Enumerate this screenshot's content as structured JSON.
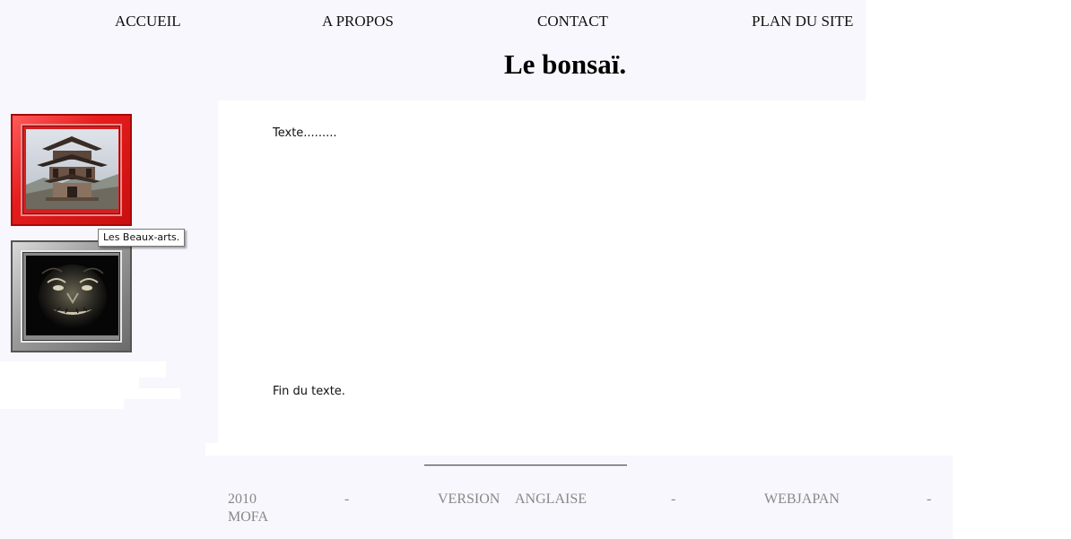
{
  "nav": {
    "items": [
      {
        "label": "ACCUEIL"
      },
      {
        "label": "A PROPOS"
      },
      {
        "label": "CONTACT"
      },
      {
        "label": "PLAN DU SITE"
      }
    ]
  },
  "header": {
    "title": "Le bonsaï."
  },
  "content": {
    "intro_text": "Texte.........",
    "end_text": "Fin du texte."
  },
  "sidebar": {
    "thumbnails": [
      {
        "image": "pagoda-image",
        "frame_color": "#e31b1b"
      },
      {
        "image": "demon-mask-image",
        "frame_color": "#9a9a9a"
      }
    ],
    "tooltip": "Les Beaux-arts."
  },
  "footer": {
    "year": "2010",
    "sep1": "-",
    "version": "VERSION",
    "language": "ANGLAISE",
    "sep2": "-",
    "webjapan": "WEBJAPAN",
    "sep3": "-",
    "mofa": "MOFA"
  },
  "colors": {
    "background_panel": "#f7f7fd",
    "content_background": "#ffffff",
    "footer_text": "#888888"
  }
}
